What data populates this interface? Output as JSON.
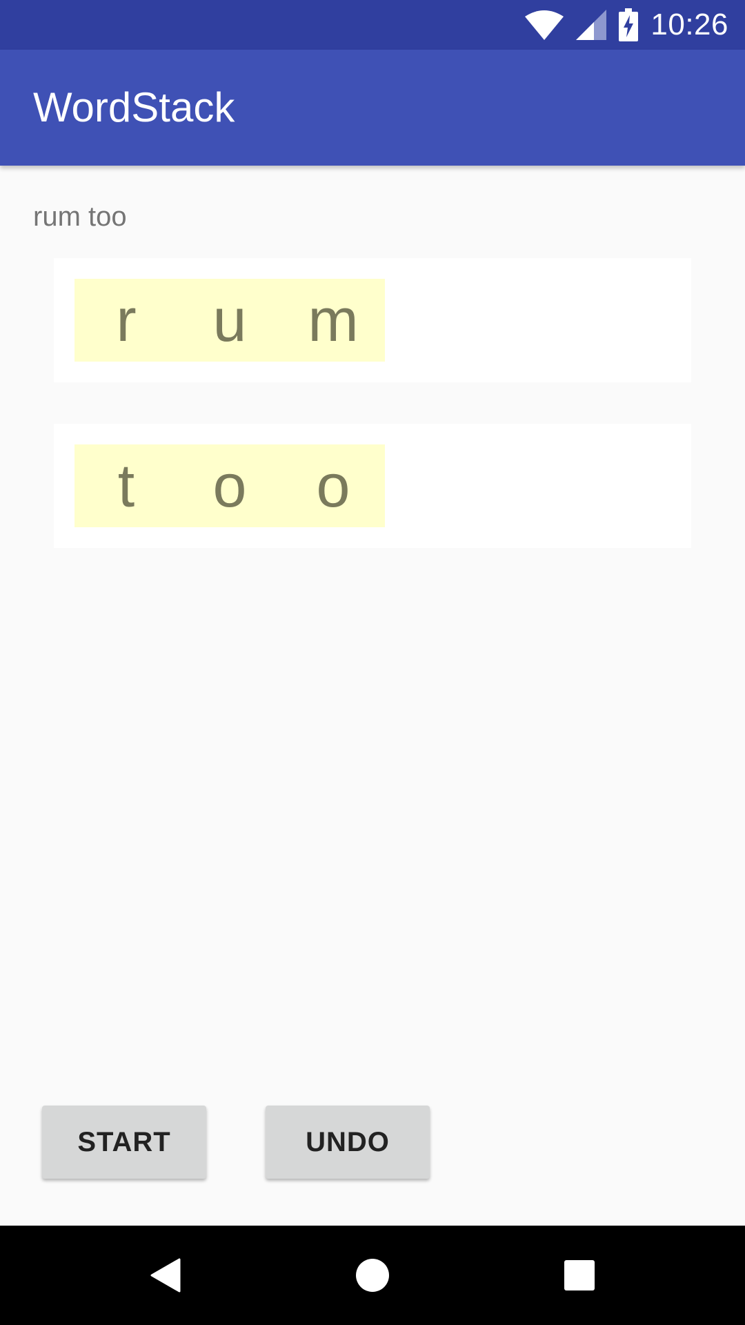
{
  "status_bar": {
    "time": "10:26",
    "icons": [
      "wifi-icon",
      "cellular-signal-icon",
      "battery-charging-icon"
    ]
  },
  "app_bar": {
    "title": "WordStack"
  },
  "main": {
    "word_display": "rum too",
    "stacks": [
      {
        "letters": [
          "r",
          "u",
          "m"
        ]
      },
      {
        "letters": [
          "t",
          "o",
          "o"
        ]
      }
    ],
    "buttons": {
      "start_label": "START",
      "undo_label": "UNDO"
    }
  },
  "nav_bar": {
    "icons": [
      "back-icon",
      "home-icon",
      "recents-icon"
    ]
  },
  "colors": {
    "status_bar": "#303f9f",
    "app_bar": "#3f51b5",
    "tile_background": "#ffffcc",
    "tile_text": "#7a7a5c",
    "button_background": "#d6d7d7"
  }
}
